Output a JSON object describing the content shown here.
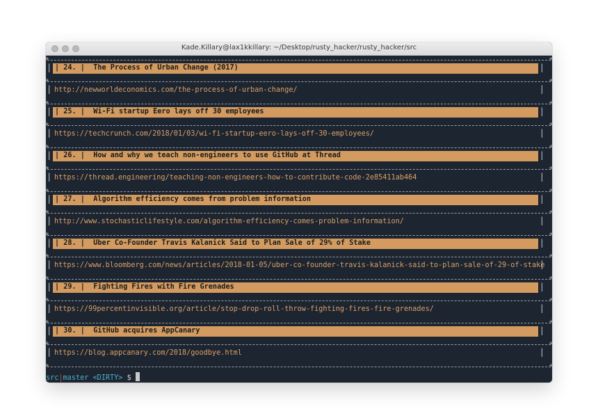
{
  "window": {
    "title": "Kade.Killary@lax1kkillary: ~/Desktop/rusty_hacker/rusty_hacker/src"
  },
  "entries": [
    {
      "num": "24.",
      "title": "The Process of Urban Change (2017)",
      "url": "http://newworldeconomics.com/the-process-of-urban-change/"
    },
    {
      "num": "25.",
      "title": "Wi-Fi startup Eero lays off 30 employees",
      "url": "https://techcrunch.com/2018/01/03/wi-fi-startup-eero-lays-off-30-employees/"
    },
    {
      "num": "26.",
      "title": "How and why we teach non-engineers to use GitHub at Thread",
      "url": "https://thread.engineering/teaching-non-engineers-how-to-contribute-code-2e85411ab464"
    },
    {
      "num": "27.",
      "title": "Algorithm efficiency comes from problem information",
      "url": "http://www.stochasticlifestyle.com/algorithm-efficiency-comes-problem-information/"
    },
    {
      "num": "28.",
      "title": "Uber Co-Founder Travis Kalanick Said to Plan Sale of 29% of Stake",
      "url": "https://www.bloomberg.com/news/articles/2018-01-05/uber-co-founder-travis-kalanick-said-to-plan-sale-of-29-of-stake"
    },
    {
      "num": "29.",
      "title": "Fighting Fires with Fire Grenades",
      "url": "https://99percentinvisible.org/article/stop-drop-roll-throw-fighting-fires-fire-grenades/"
    },
    {
      "num": "30.",
      "title": "GitHub acquires AppCanary",
      "url": "https://blog.appcanary.com/2018/goodbye.html"
    }
  ],
  "prompt": {
    "dir": "src",
    "pipe": "|",
    "branch": "master",
    "status": "<DIRTY>",
    "symbol": "$"
  },
  "colors": {
    "terminal_bg": "#1d2530",
    "header_bg": "#d39b60",
    "url_text": "#d9a06a",
    "prompt_accent": "#4eb3c9",
    "prompt_pipe": "#d14a4a"
  }
}
